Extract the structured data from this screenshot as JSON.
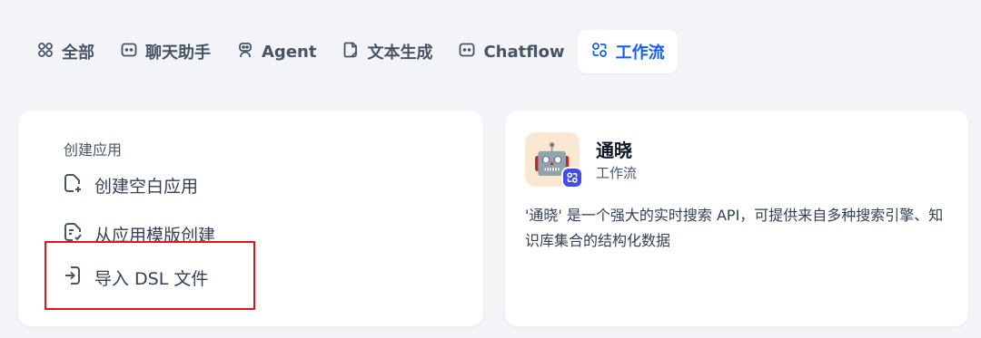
{
  "tabs": [
    {
      "label": "全部",
      "icon": "grid-icon"
    },
    {
      "label": "聊天助手",
      "icon": "chat-bubble-icon"
    },
    {
      "label": "Agent",
      "icon": "robot-icon"
    },
    {
      "label": "文本生成",
      "icon": "document-icon"
    },
    {
      "label": "Chatflow",
      "icon": "chat-bubble-icon"
    },
    {
      "label": "工作流",
      "icon": "workflow-icon",
      "active": true
    }
  ],
  "create_panel": {
    "title": "创建应用",
    "items": [
      {
        "label": "创建空白应用",
        "icon": "file-plus-icon"
      },
      {
        "label": "从应用模版创建",
        "icon": "file-list-icon"
      },
      {
        "label": "导入 DSL 文件",
        "icon": "file-import-icon"
      }
    ]
  },
  "app_card": {
    "name": "通晓",
    "type": "工作流",
    "avatar": "robot-emoji",
    "avatar_glyph": "🤖",
    "badge_icon": "workflow-icon",
    "description": "'通晓' 是一个强大的实时搜索 API，可提供来自多种搜索引擎、知识库集合的结构化数据"
  },
  "colors": {
    "background": "#f2f4f7",
    "accent": "#155eef",
    "badge": "#444ce7",
    "avatar_bg": "#fbe8d3",
    "highlight": "#e3141b"
  }
}
